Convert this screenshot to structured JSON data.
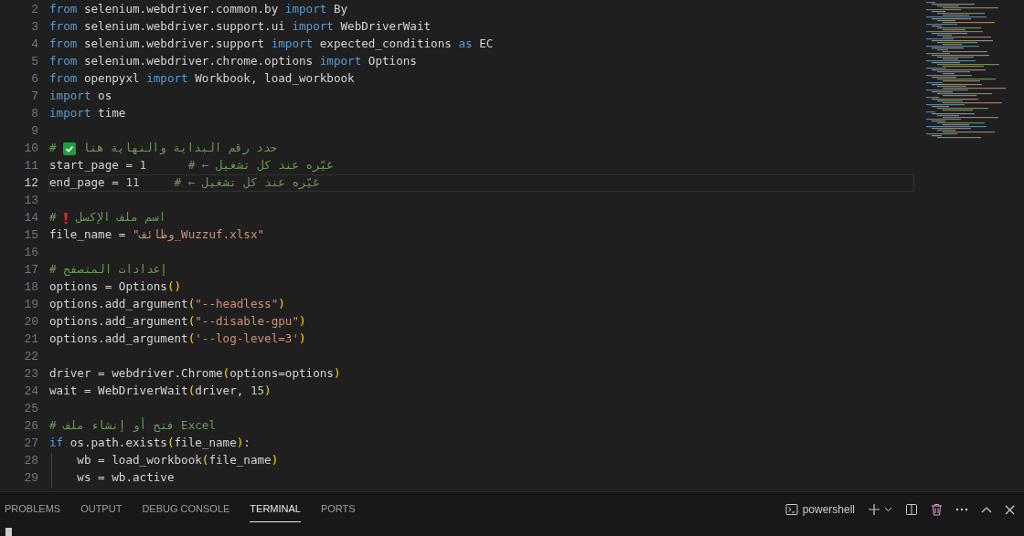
{
  "editor": {
    "lines": [
      {
        "number": "2",
        "current": false,
        "tokens": [
          {
            "kind": "kw",
            "text": "from"
          },
          {
            "kind": "id",
            "text": " selenium.webdriver.common.by "
          },
          {
            "kind": "kw",
            "text": "import"
          },
          {
            "kind": "id",
            "text": " By"
          }
        ]
      },
      {
        "number": "3",
        "current": false,
        "tokens": [
          {
            "kind": "kw",
            "text": "from"
          },
          {
            "kind": "id",
            "text": " selenium.webdriver.support.ui "
          },
          {
            "kind": "kw",
            "text": "import"
          },
          {
            "kind": "id",
            "text": " WebDriverWait"
          }
        ]
      },
      {
        "number": "4",
        "current": false,
        "tokens": [
          {
            "kind": "kw",
            "text": "from"
          },
          {
            "kind": "id",
            "text": " selenium.webdriver.support "
          },
          {
            "kind": "kw",
            "text": "import"
          },
          {
            "kind": "id",
            "text": " expected_conditions "
          },
          {
            "kind": "kw",
            "text": "as"
          },
          {
            "kind": "id",
            "text": " EC"
          }
        ]
      },
      {
        "number": "5",
        "current": false,
        "tokens": [
          {
            "kind": "kw",
            "text": "from"
          },
          {
            "kind": "id",
            "text": " selenium.webdriver.chrome.options "
          },
          {
            "kind": "kw",
            "text": "import"
          },
          {
            "kind": "id",
            "text": " Options"
          }
        ]
      },
      {
        "number": "6",
        "current": false,
        "tokens": [
          {
            "kind": "kw",
            "text": "from"
          },
          {
            "kind": "id",
            "text": " openpyxl "
          },
          {
            "kind": "kw",
            "text": "import"
          },
          {
            "kind": "id",
            "text": " Workbook, load_workbook"
          }
        ]
      },
      {
        "number": "7",
        "current": false,
        "tokens": [
          {
            "kind": "kw",
            "text": "import"
          },
          {
            "kind": "id",
            "text": " os"
          }
        ]
      },
      {
        "number": "8",
        "current": false,
        "tokens": [
          {
            "kind": "kw",
            "text": "import"
          },
          {
            "kind": "id",
            "text": " time"
          }
        ]
      },
      {
        "number": "9",
        "current": false
      },
      {
        "number": "10",
        "current": false,
        "tokens": [
          {
            "kind": "com",
            "text": "# "
          },
          {
            "kind": "check"
          },
          {
            "kind": "com",
            "text": " حدد رقم البداية والنهاية هنا"
          }
        ]
      },
      {
        "number": "11",
        "current": false,
        "tokens": [
          {
            "kind": "id",
            "text": "start_page = "
          },
          {
            "kind": "num",
            "text": "1"
          },
          {
            "kind": "com",
            "text": "      # ← غيّره عند كل تشغيل"
          }
        ]
      },
      {
        "number": "12",
        "current": true,
        "tokens": [
          {
            "kind": "id",
            "text": "end_page = "
          },
          {
            "kind": "num",
            "text": "11"
          },
          {
            "kind": "com",
            "text": "     # ← غيّره عند كل تشغيل"
          }
        ]
      },
      {
        "number": "13",
        "current": false
      },
      {
        "number": "14",
        "current": false,
        "tokens": [
          {
            "kind": "com",
            "text": "# "
          },
          {
            "kind": "bang"
          },
          {
            "kind": "com",
            "text": " اسم ملف الإكسل"
          }
        ]
      },
      {
        "number": "15",
        "current": false,
        "tokens": [
          {
            "kind": "id",
            "text": "file_name = "
          },
          {
            "kind": "str",
            "text": "\"وظائف_Wuzzuf.xlsx\""
          }
        ]
      },
      {
        "number": "16",
        "current": false
      },
      {
        "number": "17",
        "current": false,
        "tokens": [
          {
            "kind": "com",
            "text": "# إعدادات المتصفح"
          }
        ]
      },
      {
        "number": "18",
        "current": false,
        "tokens": [
          {
            "kind": "id",
            "text": "options = Options"
          },
          {
            "kind": "br",
            "text": "()"
          }
        ]
      },
      {
        "number": "19",
        "current": false,
        "tokens": [
          {
            "kind": "id",
            "text": "options.add_argument"
          },
          {
            "kind": "br",
            "text": "("
          },
          {
            "kind": "str",
            "text": "\"--headless\""
          },
          {
            "kind": "br",
            "text": ")"
          }
        ]
      },
      {
        "number": "20",
        "current": false,
        "tokens": [
          {
            "kind": "id",
            "text": "options.add_argument"
          },
          {
            "kind": "br",
            "text": "("
          },
          {
            "kind": "str",
            "text": "\"--disable-gpu\""
          },
          {
            "kind": "br",
            "text": ")"
          }
        ]
      },
      {
        "number": "21",
        "current": false,
        "tokens": [
          {
            "kind": "id",
            "text": "options.add_argument"
          },
          {
            "kind": "br",
            "text": "("
          },
          {
            "kind": "str",
            "text": "'--log-level=3'"
          },
          {
            "kind": "br",
            "text": ")"
          }
        ]
      },
      {
        "number": "22",
        "current": false
      },
      {
        "number": "23",
        "current": false,
        "tokens": [
          {
            "kind": "id",
            "text": "driver = webdriver.Chrome"
          },
          {
            "kind": "br",
            "text": "("
          },
          {
            "kind": "id",
            "text": "options=options"
          },
          {
            "kind": "br",
            "text": ")"
          }
        ]
      },
      {
        "number": "24",
        "current": false,
        "tokens": [
          {
            "kind": "id",
            "text": "wait = WebDriverWait"
          },
          {
            "kind": "br",
            "text": "("
          },
          {
            "kind": "id",
            "text": "driver, "
          },
          {
            "kind": "num",
            "text": "15"
          },
          {
            "kind": "br",
            "text": ")"
          }
        ]
      },
      {
        "number": "25",
        "current": false
      },
      {
        "number": "26",
        "current": false,
        "tokens": [
          {
            "kind": "com",
            "text": "# فتح أو إنشاء ملف Excel"
          }
        ]
      },
      {
        "number": "27",
        "current": false,
        "tokens": [
          {
            "kind": "kw",
            "text": "if"
          },
          {
            "kind": "id",
            "text": " os.path.exists"
          },
          {
            "kind": "br",
            "text": "("
          },
          {
            "kind": "id",
            "text": "file_name"
          },
          {
            "kind": "br",
            "text": ")"
          },
          {
            "kind": "id",
            "text": ":"
          }
        ]
      },
      {
        "number": "28",
        "current": false,
        "tokens": [
          {
            "kind": "id",
            "text": "    wb = load_workbook"
          },
          {
            "kind": "br",
            "text": "("
          },
          {
            "kind": "id",
            "text": "file_name"
          },
          {
            "kind": "br",
            "text": ")"
          }
        ]
      },
      {
        "number": "29",
        "current": false,
        "tokens": [
          {
            "kind": "id",
            "text": "    ws = wb.active"
          }
        ]
      }
    ]
  },
  "panel": {
    "tabs": [
      {
        "label": "PROBLEMS",
        "selected": false
      },
      {
        "label": "OUTPUT",
        "selected": false
      },
      {
        "label": "DEBUG CONSOLE",
        "selected": false
      },
      {
        "label": "TERMINAL",
        "selected": true
      },
      {
        "label": "PORTS",
        "selected": false
      }
    ],
    "terminal_name": "powershell"
  }
}
